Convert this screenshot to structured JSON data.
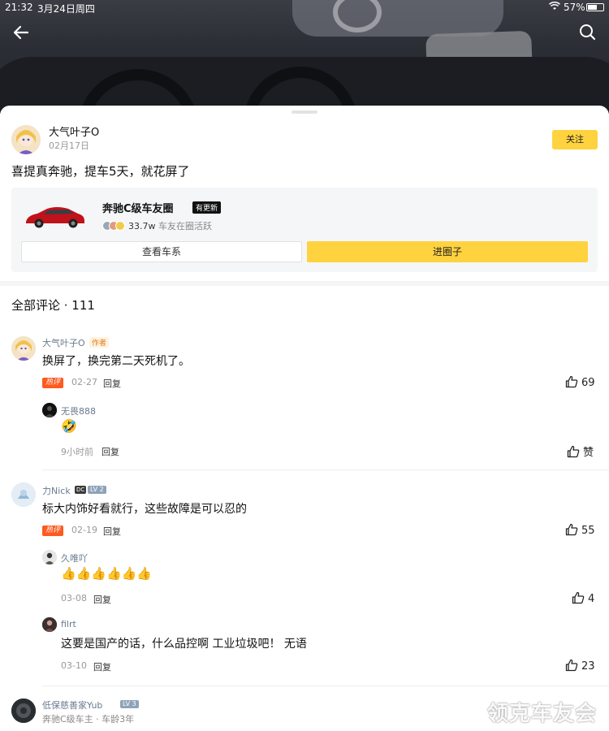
{
  "status_bar": {
    "time": "21:32",
    "date": "3月24日周四",
    "battery": "57%"
  },
  "post": {
    "author": "大气叶子O",
    "date": "02月17日",
    "follow_label": "关注",
    "text": "喜提真奔驰，提车5天，就花屏了"
  },
  "club_card": {
    "name": "奔驰C级车友圈",
    "badge": "有更新",
    "member_count": "33.7w",
    "member_text": "车友在圈活跃",
    "view_series_label": "查看车系",
    "enter_circle_label": "进圈子"
  },
  "comments_header": "全部评论 · 111",
  "comments": [
    {
      "author": "大气叶子O",
      "tag": "作者",
      "text": "换屏了，换完第二天死机了。",
      "hot_label": "热评",
      "date": "02-27",
      "reply_label": "回复",
      "likes": "69",
      "replies": [
        {
          "author": "无畏888",
          "text": "🤣",
          "date": "9小时前",
          "reply_label": "回复",
          "likes": "赞"
        }
      ]
    },
    {
      "author": "力Nick",
      "level": "LV 2",
      "dcar": "DC",
      "text": "标大内饰好看就行，这些故障是可以忍的",
      "hot_label": "热评",
      "date": "02-19",
      "reply_label": "回复",
      "likes": "55",
      "replies": [
        {
          "author": "久唯吖",
          "text": "👍👍👍👍👍👍",
          "date": "03-08",
          "reply_label": "回复",
          "likes": "4"
        },
        {
          "author": "filrt",
          "text": "这要是国产的话，什么品控啊 工业垃圾吧！ 无语",
          "date": "03-10",
          "reply_label": "回复",
          "likes": "23"
        }
      ]
    },
    {
      "author": "低保慈善家Yub",
      "level": "LV 3",
      "owner_note": "奔驰C级车主 · 车龄3年"
    }
  ],
  "watermark": "领克车友会",
  "colors": {
    "accent": "#ffd23f",
    "hot": "#ff5a1f",
    "name": "#6b7a8f"
  }
}
